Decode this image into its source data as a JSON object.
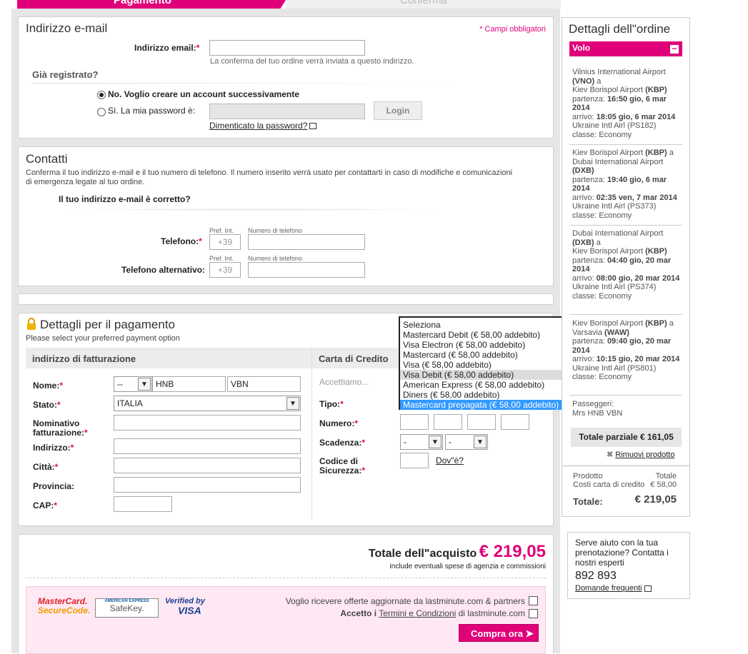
{
  "steps": {
    "payment": "Pagamento",
    "confirm": "Conferma"
  },
  "email_section": {
    "title": "Indirizzo e-mail",
    "required_note": "* Campi obbligatori",
    "email_label": "Indirizzo email:",
    "email_value": "",
    "email_hint": "La conferma del tuo ordine verrà inviata a questo indirizzo.",
    "registered_title": "Già registrato?",
    "option_no": "No. Voglio creare un account successivamente",
    "option_yes": "Sì. La mia password è:",
    "login_button": "Login",
    "forgot_link": "Dimenticato la password?"
  },
  "contacts": {
    "title": "Contatti",
    "description": "Conferma il tuo indirizzo e-mail e il tuo numero di telefono. Il numero inserito verrà usato per contattarti in caso di modifiche e comunicazioni di emergenza legate al tuo ordine.",
    "email_question": "Il tuo indirizzo e-mail è corretto?",
    "phone_label": "Telefono:",
    "alt_phone_label": "Telefono alternativo:",
    "prefix_header": "Pref. Int.",
    "number_header": "Numero di telefono",
    "prefix_value": "+39"
  },
  "payment": {
    "title": "Dettagli per il pagamento",
    "subtitle": "Please select your preferred payment option",
    "billing_header": "indirizzo di fatturazione",
    "card_header": "Carta di Credito",
    "accept_text": "Accettiamo...",
    "name_label": "Nome:",
    "title_select": "--",
    "first_name": "HNB",
    "last_name": "VBN",
    "state_label": "Stato:",
    "state_value": "ITALIA",
    "billing_name_label": "Nominativo fatturazione:",
    "address_label": "Indirizzo:",
    "city_label": "Città:",
    "province_label": "Provincia:",
    "cap_label": "CAP:",
    "type_label": "Tipo:",
    "number_label": "Numero:",
    "expiry_label": "Scadenza:",
    "expiry_month": "-",
    "expiry_year": "-",
    "security_label": "Codice di Sicurezza:",
    "where_link": "Dov\"è?",
    "card_options": [
      "Seleziona",
      "Mastercard Debit (€ 58,00 addebito)",
      "Visa Electron (€ 58,00 addebito)",
      "Mastercard (€ 58,00 addebito)",
      "Visa (€ 58,00 addebito)",
      "Visa Debit (€ 58,00 addebito)",
      "American Express (€ 58,00 addebito)",
      "Diners (€ 58,00 addebito)",
      "Mastercard prepagata (€ 58,00 addebito)"
    ]
  },
  "total_section": {
    "label": "Totale dell\"acquisto",
    "amount": "€ 219,05",
    "note": "include eventuali spese di agenzia e commissioni",
    "offers_text": "Voglio ricevere offerte aggiornate da lastminute.com & partners",
    "terms_prefix": "Accetto i",
    "terms_link": "Termini e Condizioni",
    "terms_suffix": "di lastminute.com",
    "buy_button": "Compra ora",
    "logo_mastercard_1": "MasterCard.",
    "logo_mastercard_2": "SecureCode.",
    "logo_amex_1": "AMERICAN EXPRESS",
    "logo_amex_2": "SafeKey.",
    "logo_visa_1": "Verified by",
    "logo_visa_2": "VISA"
  },
  "order": {
    "title": "Dettagli dell\"ordine",
    "flight_header": "Volo",
    "legs": [
      {
        "from": "Vilnius International Airport",
        "from_code": "(VNO)",
        "to": "Kiev Borispol Airport",
        "to_code": "(KBP)",
        "dep": "16:50 gio, 6 mar 2014",
        "arr": "18:05 gio, 6 mar 2014",
        "airline": "Ukraine Intl Airl (PS182)",
        "class": "classe: Economy"
      },
      {
        "from": "Kiev Borispol Airport",
        "from_code": "(KBP)",
        "to": "Dubai International Airport",
        "to_code": "(DXB)",
        "dep": "19:40 gio, 6 mar 2014",
        "arr": "02:35 ven, 7 mar 2014",
        "airline": "Ukraine Intl Airl (PS373)",
        "class": "classe: Economy"
      },
      {
        "from": "Dubai International Airport",
        "from_code": "(DXB)",
        "to": "Kiev Borispol Airport",
        "to_code": "(KBP)",
        "dep": "04:40 gio, 20 mar 2014",
        "arr": "08:00 gio, 20 mar 2014",
        "airline": "Ukraine Intl Airl (PS374)",
        "class": "classe: Economy"
      },
      {
        "from": "Kiev Borispol Airport",
        "from_code": "(KBP)",
        "to": "Varsavia",
        "to_code": "(WAW)",
        "dep": "09:40 gio, 20 mar 2014",
        "arr": "10:15 gio, 20 mar 2014",
        "airline": "Ukraine Intl Airl (PS801)",
        "class": "classe: Economy"
      }
    ],
    "dep_prefix": "partenza:",
    "arr_prefix": "arrivo:",
    "to_word": "a",
    "passengers_label": "Passeggeri:",
    "passenger": "Mrs HNB VBN",
    "subtotal": "Totale parziale € 161,05",
    "remove": "Rimuovi prodotto",
    "product_label": "Prodotto",
    "total_label_small": "Totale",
    "card_cost_label": "Costi carta di credito",
    "card_cost_value": "€ 58,00",
    "total_label": "Totale:",
    "total_value": "€ 219,05"
  },
  "help": {
    "text": "Serve aiuto con la tua prenotazione? Contatta i nostri esperti",
    "phone": "892 893",
    "faq": "Domande frequenti"
  }
}
